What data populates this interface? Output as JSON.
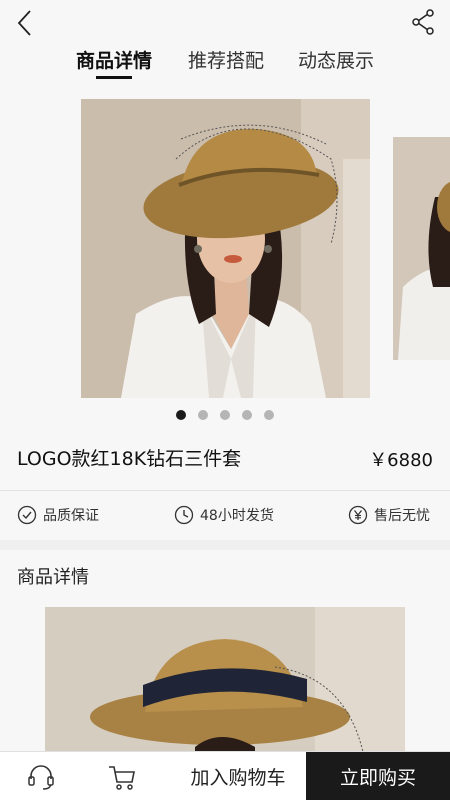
{
  "header": {
    "back_icon": "chevron-left-icon",
    "share_icon": "share-icon",
    "tabs": [
      {
        "label": "商品详情",
        "active": true
      },
      {
        "label": "推荐搭配",
        "active": false
      },
      {
        "label": "动态展示",
        "active": false
      }
    ]
  },
  "gallery": {
    "photo_description_main": "model-in-straw-hat-photo",
    "photo_description_side": "model-partial-photo",
    "slide_count": 5,
    "active_slide": 1
  },
  "product": {
    "title": "LOGO款红18K钻石三件套",
    "price": "￥6880"
  },
  "guarantees": [
    {
      "icon": "check-circle-icon",
      "label": "品质保证"
    },
    {
      "icon": "clock-icon",
      "label": "48小时发货"
    },
    {
      "icon": "yen-circle-icon",
      "label": "售后无忧"
    }
  ],
  "details": {
    "heading": "商品详情"
  },
  "bottom_bar": {
    "service_icon": "headset-icon",
    "cart_icon": "cart-icon",
    "add_to_cart_label": "加入购物车",
    "buy_now_label": "立即购买"
  },
  "colors": {
    "background": "#f7f7f7",
    "accent_dark": "#1a1a1a",
    "dot_inactive": "#b5b5b5"
  }
}
